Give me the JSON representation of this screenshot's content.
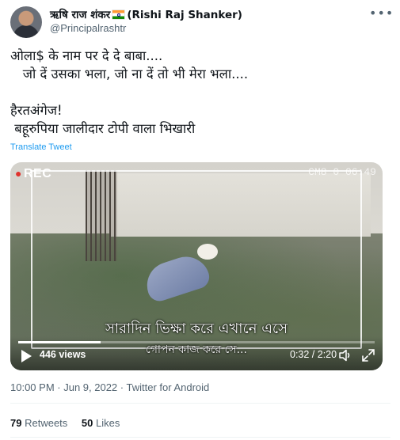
{
  "author": {
    "name_prefix": "ऋषि राज शंकर",
    "name_suffix": "(Rishi Raj Shanker)",
    "handle": "@Principalrashtr",
    "flag_icon": "india-flag-icon"
  },
  "more_icon": "more-horizontal-icon",
  "tweet": {
    "lines": [
      "ओला$ के नाम पर दे दे बाबा....",
      "   जो दें उसका भला, जो ना दें तो भी मेरा भला....",
      "",
      "हैरतअंगेज!",
      " बहूरुपिया जालीदार टोपी वाला भिखारी"
    ],
    "translate_label": "Translate Tweet"
  },
  "video": {
    "rec_label": "REC",
    "camera_label": "CM8 0 06:49",
    "subtitle_line1": "সারাদিন ভিক্ষা করে এখানে এসে",
    "subtitle_line2": "গোপন কাজ করে সে...",
    "views": "446 views",
    "time_readout": "0:32 / 2:20",
    "progress_fraction": 0.23,
    "icons": {
      "play": "play-icon",
      "volume": "volume-icon",
      "fullscreen": "fullscreen-icon"
    }
  },
  "meta": {
    "time": "10:00 PM",
    "separator": " · ",
    "date": "Jun 9, 2022",
    "source": "Twitter for Android"
  },
  "stats": {
    "retweets_count": "79",
    "retweets_label": "Retweets",
    "likes_count": "50",
    "likes_label": "Likes"
  }
}
